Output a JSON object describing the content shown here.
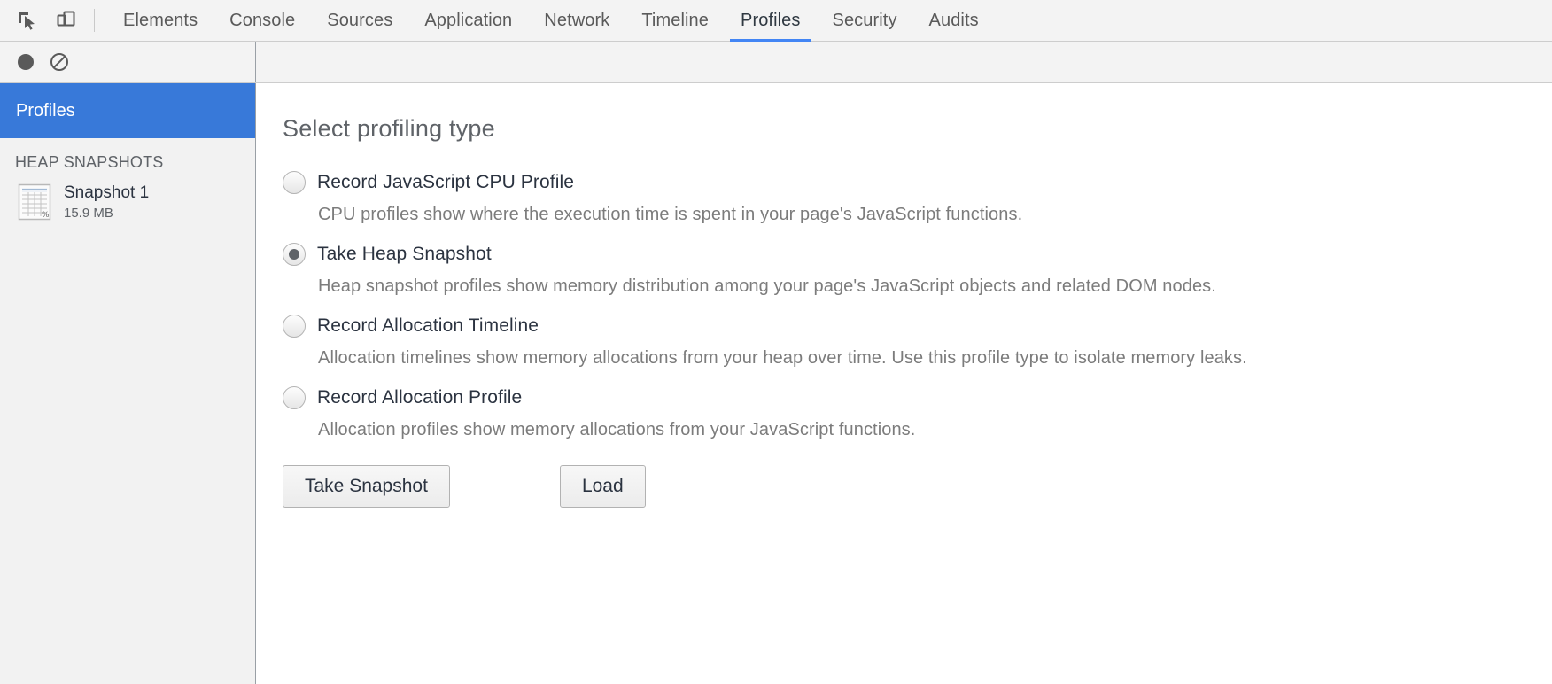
{
  "toolbar": {
    "inspect_icon": "inspect-cursor-icon",
    "device_toolbar_icon": "device-toolbar-icon",
    "tabs": [
      {
        "label": "Elements",
        "active": false
      },
      {
        "label": "Console",
        "active": false
      },
      {
        "label": "Sources",
        "active": false
      },
      {
        "label": "Application",
        "active": false
      },
      {
        "label": "Network",
        "active": false
      },
      {
        "label": "Timeline",
        "active": false
      },
      {
        "label": "Profiles",
        "active": true
      },
      {
        "label": "Security",
        "active": false
      },
      {
        "label": "Audits",
        "active": false
      }
    ],
    "active_tab": "Profiles",
    "accent_color": "#4285f4"
  },
  "panel_toolbar": {
    "record_icon": "record-circle-icon",
    "clear_icon": "clear-no-entry-icon"
  },
  "sidebar": {
    "selected_section": "Profiles",
    "selected_color": "#3879d9",
    "group_title": "HEAP SNAPSHOTS",
    "snapshots": [
      {
        "icon": "heap-snapshot-icon",
        "name": "Snapshot 1",
        "size": "15.9 MB"
      }
    ]
  },
  "content": {
    "title": "Select profiling type",
    "options": [
      {
        "label": "Record JavaScript CPU Profile",
        "description": "CPU profiles show where the execution time is spent in your page's JavaScript functions.",
        "selected": false
      },
      {
        "label": "Take Heap Snapshot",
        "description": "Heap snapshot profiles show memory distribution among your page's JavaScript objects and related DOM nodes.",
        "selected": true
      },
      {
        "label": "Record Allocation Timeline",
        "description": "Allocation timelines show memory allocations from your heap over time. Use this profile type to isolate memory leaks.",
        "selected": false
      },
      {
        "label": "Record Allocation Profile",
        "description": "Allocation profiles show memory allocations from your JavaScript functions.",
        "selected": false
      }
    ],
    "primary_button": "Take Snapshot",
    "secondary_button": "Load"
  }
}
